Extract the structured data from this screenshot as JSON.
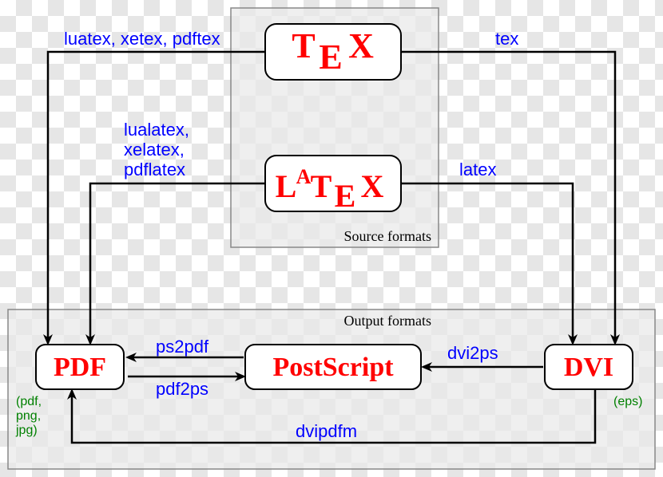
{
  "nodes": {
    "tex": "TEX",
    "latex": "LATEX",
    "pdf": "PDF",
    "postscript": "PostScript",
    "dvi": "DVI"
  },
  "edges": {
    "tex_to_pdf": "luatex, xetex, pdftex",
    "tex_to_dvi": "tex",
    "latex_to_pdf_l1": "lualatex,",
    "latex_to_pdf_l2": "xelatex,",
    "latex_to_pdf_l3": "pdflatex",
    "latex_to_dvi": "latex",
    "ps_to_pdf": "ps2pdf",
    "pdf_to_ps": "pdf2ps",
    "dvi_to_ps": "dvi2ps",
    "dvi_to_pdf": "dvipdfm"
  },
  "groups": {
    "source": "Source formats",
    "output": "Output formats"
  },
  "extensions": {
    "pdf_l1": "(pdf,",
    "pdf_l2": "png,",
    "pdf_l3": "jpg)",
    "dvi": "(eps)"
  }
}
